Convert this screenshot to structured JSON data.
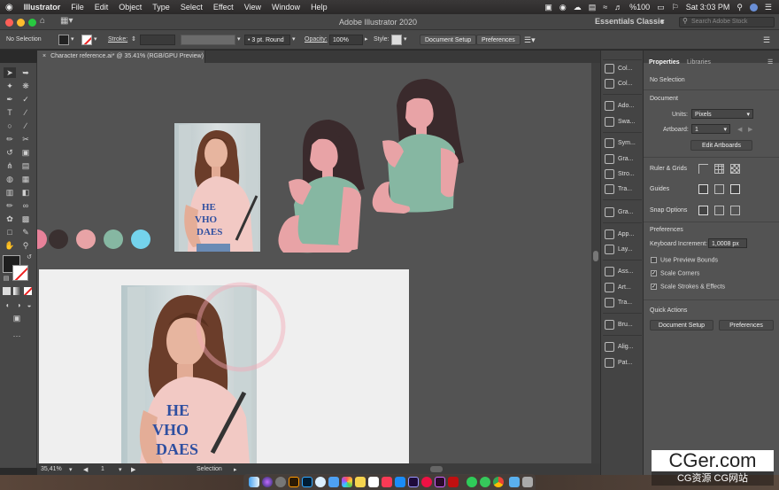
{
  "menubar": {
    "apple": "",
    "app_name": "Illustrator",
    "items": [
      "File",
      "Edit",
      "Object",
      "Type",
      "Select",
      "Effect",
      "View",
      "Window",
      "Help"
    ],
    "status": {
      "battery": "%100",
      "clock": "Sat 3:03 PM"
    }
  },
  "titlebar": {
    "title": "Adobe Illustrator 2020",
    "workspace": "Essentials Classic",
    "search_placeholder": "Search Adobe Stock"
  },
  "control": {
    "selection": "No Selection",
    "stroke_label": "Stroke:",
    "brush": "3 pt. Round",
    "opacity_label": "Opacity:",
    "opacity": "100%",
    "style_label": "Style:",
    "doc_setup": "Document Setup",
    "preferences": "Preferences"
  },
  "tab": {
    "close": "×",
    "name": "Character reference.ai* @ 35.41% (RGB/GPU Preview)"
  },
  "status": {
    "zoom": "35,41%",
    "artboard": "1",
    "tool": "Selection"
  },
  "swatches": [
    "#e8829a",
    "#3a3030",
    "#e8a3a6",
    "#86b7a2",
    "#74d3ec"
  ],
  "colors": {
    "skin": "#e8a3a6",
    "hair": "#3a2a2c",
    "shirt": "#86b7a2",
    "accent": "#f4a9b5"
  },
  "panels": [
    {
      "icon": "color-icon",
      "label": "Col..."
    },
    {
      "icon": "color-guide-icon",
      "label": "Col..."
    },
    {
      "icon": "adobe-color-icon",
      "label": "Ado..."
    },
    {
      "icon": "swatches-icon",
      "label": "Swa..."
    },
    {
      "icon": "symbols-icon",
      "label": "Sym..."
    },
    {
      "icon": "graphic-styles-icon",
      "label": "Gra..."
    },
    {
      "icon": "stroke-icon",
      "label": "Stro..."
    },
    {
      "icon": "transparency-icon",
      "label": "Tra..."
    },
    {
      "icon": "gradient-icon",
      "label": "Gra..."
    },
    {
      "icon": "appearance-icon",
      "label": "App..."
    },
    {
      "icon": "layers-icon",
      "label": "Lay..."
    },
    {
      "icon": "asset-export-icon",
      "label": "Ass..."
    },
    {
      "icon": "artboards-icon",
      "label": "Art..."
    },
    {
      "icon": "transform-icon",
      "label": "Tra..."
    },
    {
      "icon": "brushes-icon",
      "label": "Bru..."
    },
    {
      "icon": "align-icon",
      "label": "Alig..."
    },
    {
      "icon": "pathfinder-icon",
      "label": "Pat..."
    }
  ],
  "properties": {
    "tabs": [
      "Properties",
      "Libraries"
    ],
    "no_selection": "No Selection",
    "document_title": "Document",
    "units_label": "Units:",
    "units": "Pixels",
    "artboard_label": "Artboard:",
    "artboard": "1",
    "edit_artboards": "Edit Artboards",
    "ruler_grids": "Ruler & Grids",
    "guides": "Guides",
    "snap_options": "Snap Options",
    "preferences_title": "Preferences",
    "keyboard_increment_label": "Keyboard Increment:",
    "keyboard_increment": "1,0008 px",
    "use_preview_bounds": "Use Preview Bounds",
    "use_preview_bounds_checked": false,
    "scale_corners": "Scale Corners",
    "scale_corners_checked": true,
    "scale_strokes": "Scale Strokes & Effects",
    "scale_strokes_checked": true,
    "quick_actions": "Quick Actions",
    "document_setup": "Document Setup",
    "preferences_btn": "Preferences"
  },
  "photo": {
    "shirt_text": [
      "HE",
      "VHO",
      "DAES"
    ],
    "shirt_text_big": [
      "HE",
      "VHO",
      "DAES"
    ]
  },
  "watermark": {
    "line1": "CGer.com",
    "line2": "CG资源 CG网站"
  }
}
